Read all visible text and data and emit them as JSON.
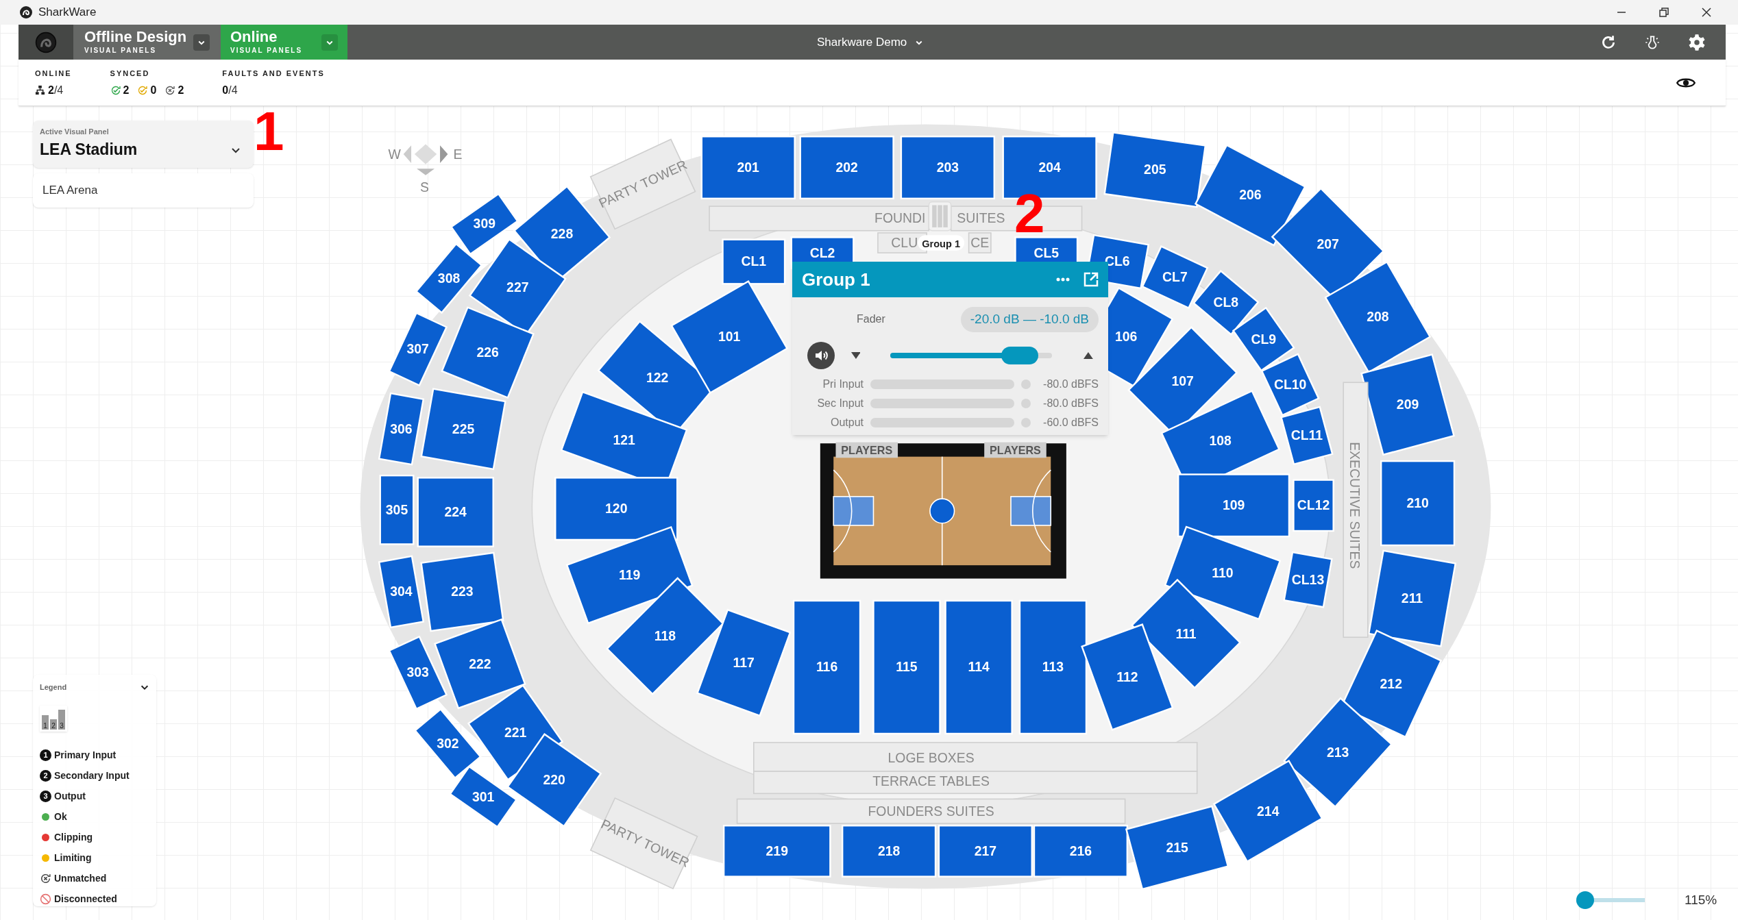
{
  "app_title": "SharkWare",
  "toolbar": {
    "modes": [
      {
        "title": "Offline Design",
        "subtitle": "VISUAL PANELS",
        "selected": false
      },
      {
        "title": "Online",
        "subtitle": "VISUAL PANELS",
        "selected": true
      }
    ],
    "project": "Sharkware Demo"
  },
  "status": {
    "online": {
      "label": "ONLINE",
      "value": "2",
      "total": "/4"
    },
    "synced": {
      "label": "SYNCED",
      "counts": [
        {
          "kind": "ok",
          "value": "2"
        },
        {
          "kind": "limiting",
          "value": "0"
        },
        {
          "kind": "unmatched",
          "value": "2"
        }
      ]
    },
    "faults": {
      "label": "FAULTS AND EVENTS",
      "value": "0",
      "total": "/4"
    }
  },
  "panel_selector": {
    "label": "Active Visual Panel",
    "value": "LEA Stadium",
    "options": [
      "LEA Arena"
    ]
  },
  "annotations": [
    "1",
    "2"
  ],
  "map": {
    "compass": [
      "W",
      "E",
      "S"
    ],
    "sections": [
      {
        "label": "201"
      },
      {
        "label": "202"
      },
      {
        "label": "203"
      },
      {
        "label": "204"
      },
      {
        "label": "205"
      },
      {
        "label": "206"
      },
      {
        "label": "207"
      },
      {
        "label": "208"
      },
      {
        "label": "209"
      },
      {
        "label": "210"
      },
      {
        "label": "211"
      },
      {
        "label": "212"
      },
      {
        "label": "213"
      },
      {
        "label": "214"
      },
      {
        "label": "219"
      },
      {
        "label": "218"
      },
      {
        "label": "217"
      },
      {
        "label": "216"
      },
      {
        "label": "215"
      },
      {
        "label": "228"
      },
      {
        "label": "227"
      },
      {
        "label": "226"
      },
      {
        "label": "225"
      },
      {
        "label": "224"
      },
      {
        "label": "223"
      },
      {
        "label": "222"
      },
      {
        "label": "221"
      },
      {
        "label": "220"
      },
      {
        "label": "309"
      },
      {
        "label": "308"
      },
      {
        "label": "307"
      },
      {
        "label": "306"
      },
      {
        "label": "305"
      },
      {
        "label": "304"
      },
      {
        "label": "303"
      },
      {
        "label": "302"
      },
      {
        "label": "301"
      },
      {
        "label": "CL1"
      },
      {
        "label": "CL2"
      },
      {
        "label": "CL5"
      },
      {
        "label": "CL6"
      },
      {
        "label": "CL7"
      },
      {
        "label": "CL8"
      },
      {
        "label": "CL9"
      },
      {
        "label": "CL10"
      },
      {
        "label": "CL11"
      },
      {
        "label": "CL12"
      },
      {
        "label": "CL13"
      },
      {
        "label": "122"
      },
      {
        "label": "101"
      },
      {
        "label": "106"
      },
      {
        "label": "107"
      },
      {
        "label": "121"
      },
      {
        "label": "108"
      },
      {
        "label": "120"
      },
      {
        "label": "109"
      },
      {
        "label": "119"
      },
      {
        "label": "110"
      },
      {
        "label": "118"
      },
      {
        "label": "111"
      },
      {
        "label": "117"
      },
      {
        "label": "116"
      },
      {
        "label": "115"
      },
      {
        "label": "114"
      },
      {
        "label": "113"
      },
      {
        "label": "112"
      }
    ],
    "areas": [
      {
        "label": "FOUNDI"
      },
      {
        "label": "SUITES"
      },
      {
        "label": "CLU"
      },
      {
        "label": "CE"
      },
      {
        "label": "LOGE BOXES"
      },
      {
        "label": "TERRACE TABLES"
      },
      {
        "label": "FOUNDERS SUITES"
      },
      {
        "label": "PARTY TOWER"
      },
      {
        "label": "PARTY TOWER"
      },
      {
        "label": "EXECUTIVE SUITES"
      }
    ],
    "court_labels": [
      "PLAYERS",
      "PLAYERS"
    ],
    "group_marker": "Group 1"
  },
  "group_popup": {
    "title": "Group 1",
    "fader_label": "Fader",
    "fader_range": "-20.0 dB — -10.0 dB",
    "muted": false,
    "level": 0.8,
    "meters": [
      {
        "label": "Pri Input",
        "level": 0,
        "reading": "-80.0 dBFS"
      },
      {
        "label": "Sec Input",
        "level": 0,
        "reading": "-80.0 dBFS"
      },
      {
        "label": "Output",
        "level": 0,
        "reading": "-60.0 dBFS"
      }
    ]
  },
  "legend": {
    "title": "Legend",
    "meter_icon_labels": [
      "1",
      "2",
      "3"
    ],
    "items": [
      {
        "kind": "number",
        "icon": "1",
        "label": "Primary Input"
      },
      {
        "kind": "number",
        "icon": "2",
        "label": "Secondary Input"
      },
      {
        "kind": "number",
        "icon": "3",
        "label": "Output"
      },
      {
        "kind": "dot",
        "color": "#4caf50",
        "label": "Ok"
      },
      {
        "kind": "dot",
        "color": "#e53935",
        "label": "Clipping"
      },
      {
        "kind": "dot",
        "color": "#f5b800",
        "label": "Limiting"
      },
      {
        "kind": "unmatched",
        "label": "Unmatched"
      },
      {
        "kind": "disconnected",
        "label": "Disconnected"
      }
    ]
  },
  "zoom": {
    "level": 0,
    "reading": "115%"
  }
}
